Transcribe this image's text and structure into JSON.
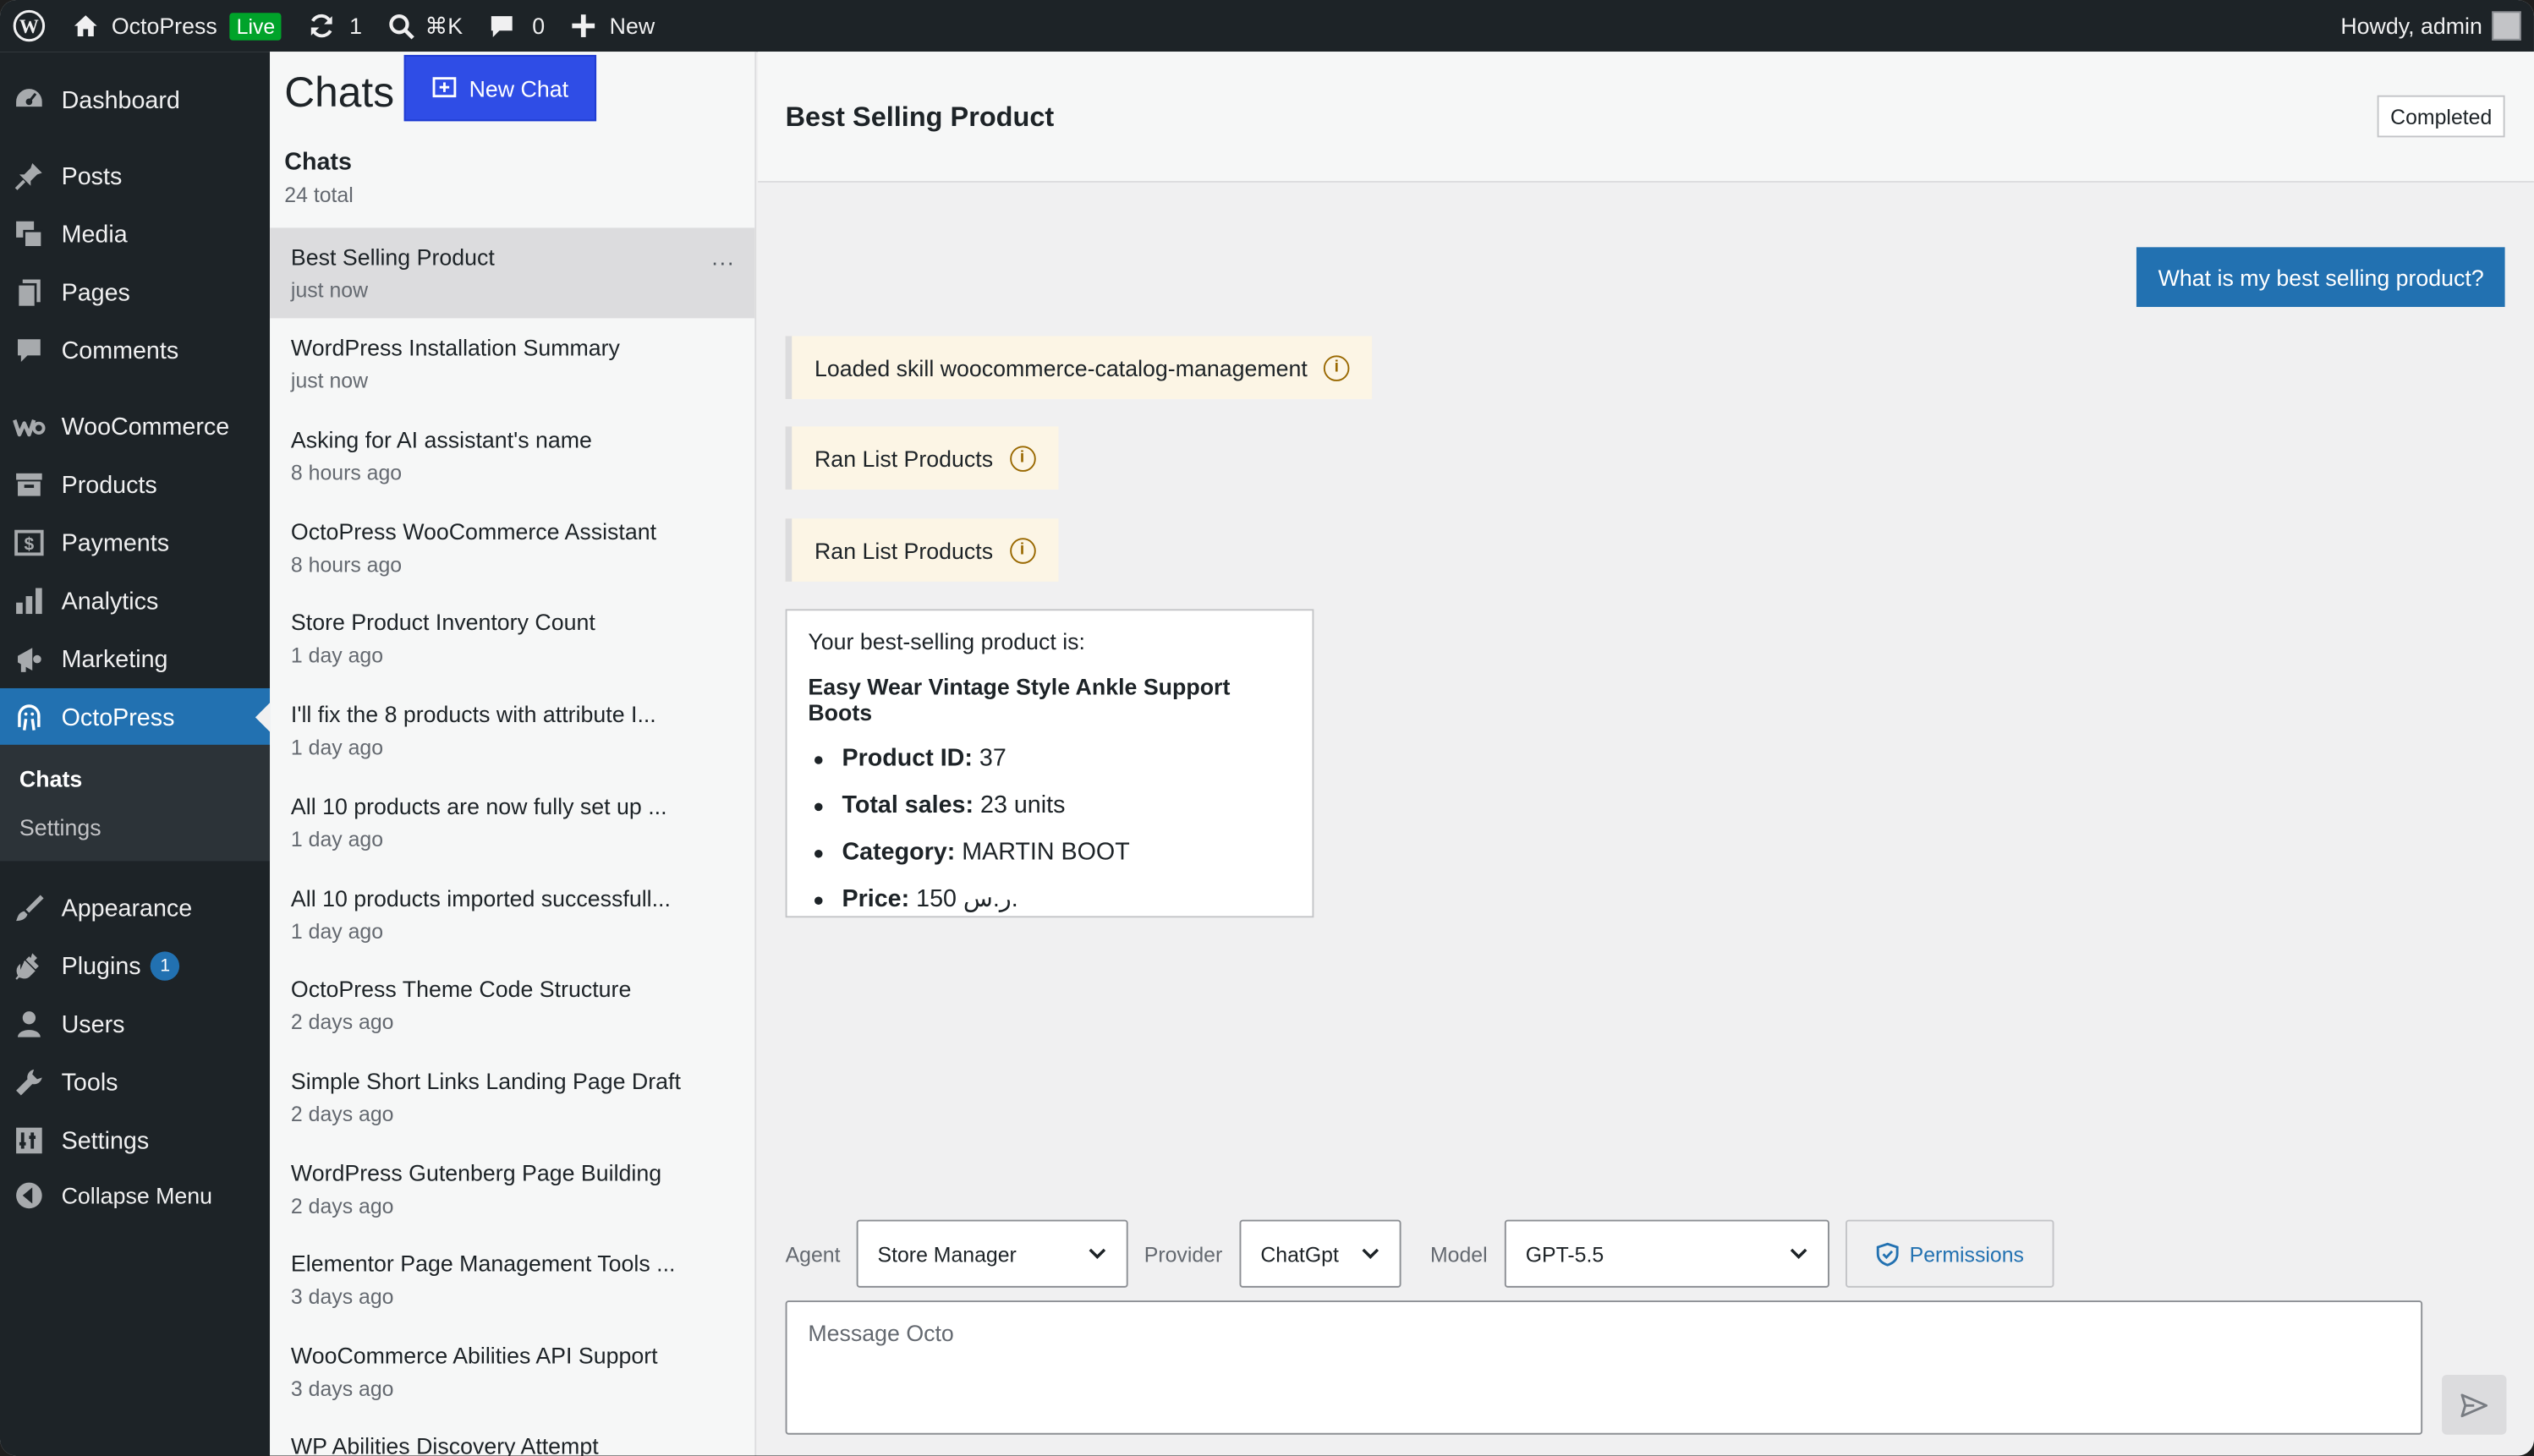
{
  "adminbar": {
    "site_name": "OctoPress",
    "live_label": "Live",
    "updates_count": "1",
    "search_shortcut": "⌘K",
    "comments_count": "0",
    "new_label": "New",
    "howdy": "Howdy, admin"
  },
  "menu": {
    "items": [
      {
        "label": "Dashboard",
        "icon": "dashboard-icon"
      },
      {
        "label": "Posts",
        "icon": "pin-icon"
      },
      {
        "label": "Media",
        "icon": "media-icon"
      },
      {
        "label": "Pages",
        "icon": "pages-icon"
      },
      {
        "label": "Comments",
        "icon": "comment-icon"
      },
      {
        "label": "WooCommerce",
        "icon": "woo-icon"
      },
      {
        "label": "Products",
        "icon": "archive-icon"
      },
      {
        "label": "Payments",
        "icon": "dollar-icon"
      },
      {
        "label": "Analytics",
        "icon": "bar-chart-icon"
      },
      {
        "label": "Marketing",
        "icon": "megaphone-icon"
      },
      {
        "label": "OctoPress",
        "icon": "octopus-icon"
      },
      {
        "label": "Appearance",
        "icon": "brush-icon"
      },
      {
        "label": "Plugins",
        "icon": "plug-icon",
        "badge": "1"
      },
      {
        "label": "Users",
        "icon": "user-icon"
      },
      {
        "label": "Tools",
        "icon": "wrench-icon"
      },
      {
        "label": "Settings",
        "icon": "settings-icon"
      },
      {
        "label": "Collapse Menu",
        "icon": "collapse-icon"
      }
    ],
    "submenu": [
      "Chats",
      "Settings"
    ]
  },
  "chats": {
    "title": "Chats",
    "new_chat_label": "New Chat",
    "list_title": "Chats",
    "total": "24 total",
    "items": [
      {
        "title": "Best Selling Product",
        "time": "just now"
      },
      {
        "title": "WordPress Installation Summary",
        "time": "just now"
      },
      {
        "title": "Asking for AI assistant's name",
        "time": "8 hours ago"
      },
      {
        "title": "OctoPress WooCommerce Assistant",
        "time": "8 hours ago"
      },
      {
        "title": "Store Product Inventory Count",
        "time": "1 day ago"
      },
      {
        "title": "I'll fix the 8 products with attribute I...",
        "time": "1 day ago"
      },
      {
        "title": "All 10 products are now fully set up ...",
        "time": "1 day ago"
      },
      {
        "title": "All 10 products imported successfull...",
        "time": "1 day ago"
      },
      {
        "title": "OctoPress Theme Code Structure",
        "time": "2 days ago"
      },
      {
        "title": "Simple Short Links Landing Page Draft",
        "time": "2 days ago"
      },
      {
        "title": "WordPress Gutenberg Page Building",
        "time": "2 days ago"
      },
      {
        "title": "Elementor Page Management Tools ...",
        "time": "3 days ago"
      },
      {
        "title": "WooCommerce Abilities API Support",
        "time": "3 days ago"
      },
      {
        "title": "WP Abilities Discovery Attempt",
        "time": ""
      }
    ],
    "more_label": "..."
  },
  "conversation": {
    "title": "Best Selling Product",
    "status": "Completed",
    "user_message": "What is my best selling product?",
    "tool_messages": [
      "Loaded skill woocommerce-catalog-management",
      "Ran List Products",
      "Ran List Products"
    ],
    "answer": {
      "intro": "Your best-selling product is:",
      "product": "Easy Wear Vintage Style Ankle Support Boots",
      "details": [
        {
          "label": "Product ID:",
          "value": "37"
        },
        {
          "label": "Total sales:",
          "value": "23 units"
        },
        {
          "label": "Category:",
          "value": "MARTIN BOOT"
        },
        {
          "label": "Price:",
          "value": "150 ر.س."
        }
      ]
    }
  },
  "composer": {
    "agent_label": "Agent",
    "agent_value": "Store Manager",
    "provider_label": "Provider",
    "provider_value": "ChatGpt",
    "model_label": "Model",
    "model_value": "GPT-5.5",
    "permissions_label": "Permissions",
    "placeholder": "Message Octo"
  },
  "colors": {
    "accent": "#2271b1",
    "new_chat": "#2f4de6",
    "adminbar": "#1d2327",
    "live": "#00a32a",
    "tool_bg": "#fcf5e5"
  }
}
